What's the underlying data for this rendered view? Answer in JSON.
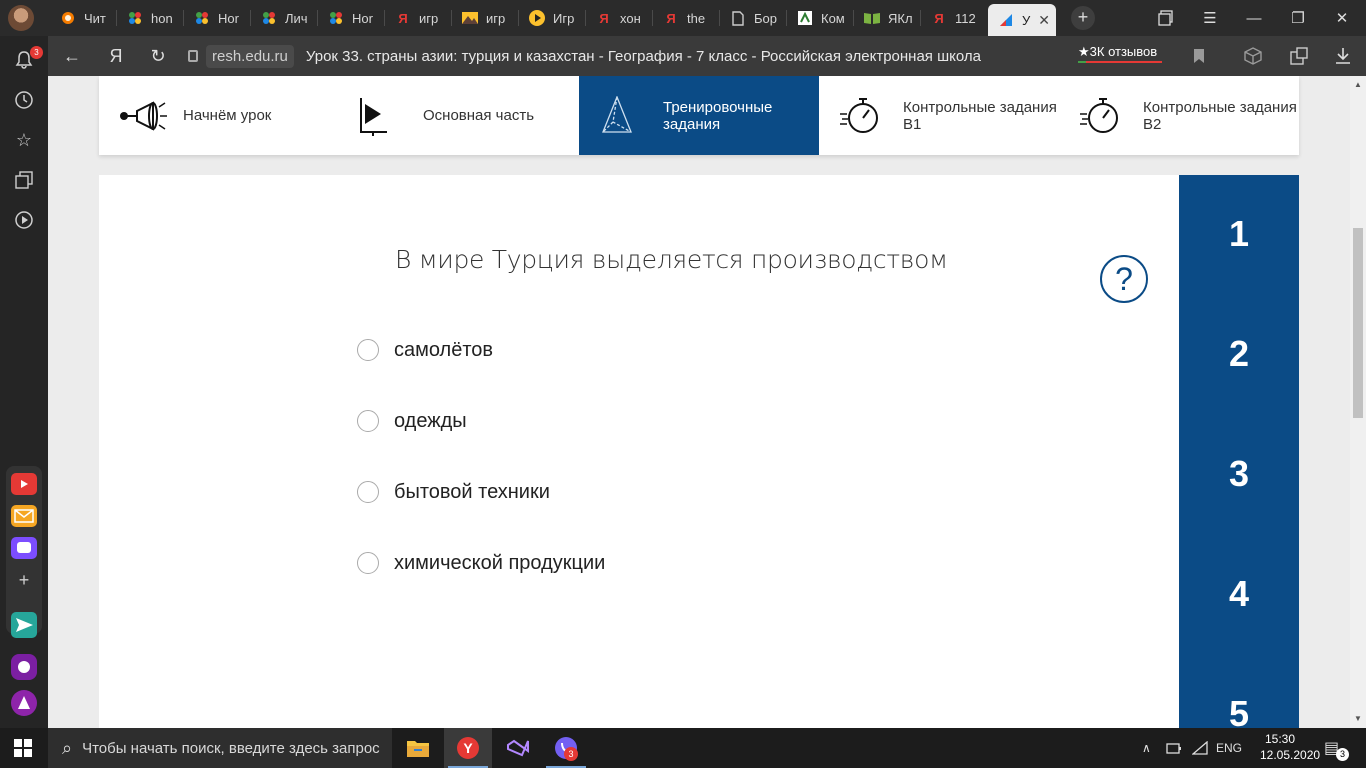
{
  "browser": {
    "tabs": [
      {
        "label": "Чит",
        "icon": "orange-circle-icon",
        "color": "#f57c00"
      },
      {
        "label": "hon",
        "icon": "dots-icon",
        "color": "#43a047"
      },
      {
        "label": "Нor",
        "icon": "dots-icon",
        "color": "#43a047"
      },
      {
        "label": "Лич",
        "icon": "dots-icon",
        "color": "#43a047"
      },
      {
        "label": "Нor",
        "icon": "dots-icon",
        "color": "#43a047"
      },
      {
        "label": "игр",
        "icon": "yandex-icon",
        "color": "#e53935"
      },
      {
        "label": "игр",
        "icon": "image-icon",
        "color": "#fbc02d"
      },
      {
        "label": "Игр",
        "icon": "play-icon",
        "color": "#fbc02d"
      },
      {
        "label": "хон",
        "icon": "yandex-icon",
        "color": "#e53935"
      },
      {
        "label": "the",
        "icon": "yandex-icon",
        "color": "#e53935"
      },
      {
        "label": "Бор",
        "icon": "document-icon",
        "color": "#cccccc"
      },
      {
        "label": "Ком",
        "icon": "kom-icon",
        "color": "#2e7d32"
      },
      {
        "label": "ЯКл",
        "icon": "book-icon",
        "color": "#7cb342"
      },
      {
        "label": "112",
        "icon": "yandex-icon",
        "color": "#e53935"
      },
      {
        "label": "У",
        "icon": "resh-icon",
        "color": "#1e88e5"
      }
    ],
    "url_domain": "resh.edu.ru",
    "page_title": "Урок 33. страны азии: турция и казахстан - География - 7 класс - Российская электронная школа",
    "reviews_label": "★3К отзывов",
    "notification_count": "3"
  },
  "lesson_nav": {
    "items": [
      {
        "label": "Начнём урок",
        "icon": "megaphone-icon"
      },
      {
        "label": "Основная часть",
        "icon": "play-board-icon"
      },
      {
        "label": "Тренировочные задания",
        "icon": "pyramid-icon"
      },
      {
        "label": "Контрольные задания В1",
        "icon": "stopwatch-icon"
      },
      {
        "label": "Контрольные задания В2",
        "icon": "stopwatch-icon"
      }
    ],
    "active_index": 2
  },
  "task": {
    "question": "В мире Турция выделяется производством",
    "help_symbol": "?",
    "options": [
      "самолётов",
      "одежды",
      "бытовой техники",
      "химической продукции"
    ]
  },
  "task_numbers": [
    "1",
    "2",
    "3",
    "4",
    "5"
  ],
  "taskbar": {
    "search_placeholder": "Чтобы начать поиск, введите здесь запрос",
    "language": "ENG",
    "time": "15:30",
    "date": "12.05.2020",
    "notification_count": "3",
    "viber_badge": "3"
  },
  "colors": {
    "accent": "#0b4b86",
    "tab_strip": "#2b2b2b",
    "address_bar": "#3a3a3a"
  }
}
